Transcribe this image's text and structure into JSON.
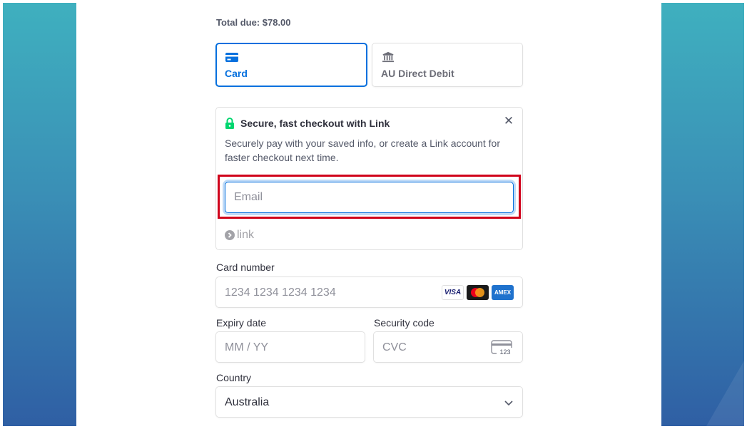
{
  "checkout": {
    "total_due": "Total due: $78.00"
  },
  "tabs": [
    {
      "label": "Card",
      "icon": "card-icon",
      "selected": true
    },
    {
      "label": "AU Direct Debit",
      "icon": "bank-icon",
      "selected": false
    }
  ],
  "link": {
    "title": "Secure, fast checkout with Link",
    "description": "Securely pay with your saved info, or create a Link account for faster checkout next time.",
    "email_placeholder": "Email",
    "email_value": "",
    "logo_text": "link",
    "close_icon": "close-icon",
    "lock_icon": "lock-icon"
  },
  "card_number": {
    "label": "Card number",
    "placeholder": "1234 1234 1234 1234",
    "brands": [
      "VISA",
      "mastercard",
      "AMEX"
    ]
  },
  "expiry": {
    "label": "Expiry date",
    "placeholder": "MM / YY"
  },
  "security_code": {
    "label": "Security code",
    "placeholder": "CVC",
    "icon_text": "123"
  },
  "country": {
    "label": "Country",
    "value": "Australia"
  },
  "colors": {
    "accent": "#0570de",
    "highlight": "#d0021b",
    "link_green": "#00d66f",
    "side_gradient_top": "#3fb0bf",
    "side_gradient_bottom": "#2f5fa4"
  }
}
